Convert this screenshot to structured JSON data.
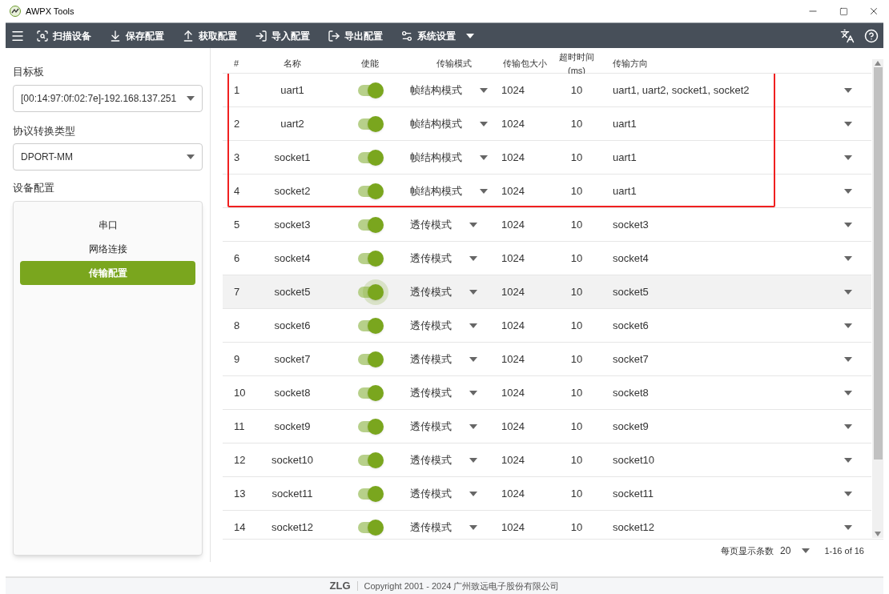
{
  "window": {
    "title": "AWPX Tools"
  },
  "toolbar": [
    {
      "label": "扫描设备",
      "kind": "scan"
    },
    {
      "label": "保存配置",
      "kind": "save"
    },
    {
      "label": "获取配置",
      "kind": "fetch"
    },
    {
      "label": "导入配置",
      "kind": "import"
    },
    {
      "label": "导出配置",
      "kind": "export"
    },
    {
      "label": "系统设置",
      "kind": "settings"
    }
  ],
  "sidebar": {
    "target_label": "目标板",
    "target_value": "[00:14:97:0f:02:7e]-192.168.137.251",
    "protocol_label": "协议转换类型",
    "protocol_value": "DPORT-MM",
    "config_label": "设备配置",
    "config_items": [
      {
        "label": "串口",
        "selected": false
      },
      {
        "label": "网络连接",
        "selected": false
      },
      {
        "label": "传输配置",
        "selected": true
      }
    ]
  },
  "table": {
    "columns": [
      "#",
      "名称",
      "使能",
      "传输模式",
      "传输包大小",
      "超时时间(ms)",
      "传输方向"
    ],
    "rows": [
      {
        "index": "1",
        "name": "uart1",
        "on": true,
        "mode": "帧结构模式",
        "size": "1024",
        "timeout": "10",
        "direction": "uart1, uart2, socket1, socket2",
        "outlined": true,
        "highlighted": false
      },
      {
        "index": "2",
        "name": "uart2",
        "on": true,
        "mode": "帧结构模式",
        "size": "1024",
        "timeout": "10",
        "direction": "uart1",
        "outlined": true,
        "highlighted": false
      },
      {
        "index": "3",
        "name": "socket1",
        "on": true,
        "mode": "帧结构模式",
        "size": "1024",
        "timeout": "10",
        "direction": "uart1",
        "outlined": true,
        "highlighted": false
      },
      {
        "index": "4",
        "name": "socket2",
        "on": true,
        "mode": "帧结构模式",
        "size": "1024",
        "timeout": "10",
        "direction": "uart1",
        "outlined": true,
        "highlighted": false
      },
      {
        "index": "5",
        "name": "socket3",
        "on": true,
        "mode": "透传模式",
        "size": "1024",
        "timeout": "10",
        "direction": "socket3",
        "outlined": false,
        "highlighted": false
      },
      {
        "index": "6",
        "name": "socket4",
        "on": true,
        "mode": "透传模式",
        "size": "1024",
        "timeout": "10",
        "direction": "socket4",
        "outlined": false,
        "highlighted": false
      },
      {
        "index": "7",
        "name": "socket5",
        "on": true,
        "mode": "透传模式",
        "size": "1024",
        "timeout": "10",
        "direction": "socket5",
        "outlined": false,
        "highlighted": true
      },
      {
        "index": "8",
        "name": "socket6",
        "on": true,
        "mode": "透传模式",
        "size": "1024",
        "timeout": "10",
        "direction": "socket6",
        "outlined": false,
        "highlighted": false
      },
      {
        "index": "9",
        "name": "socket7",
        "on": true,
        "mode": "透传模式",
        "size": "1024",
        "timeout": "10",
        "direction": "socket7",
        "outlined": false,
        "highlighted": false
      },
      {
        "index": "10",
        "name": "socket8",
        "on": true,
        "mode": "透传模式",
        "size": "1024",
        "timeout": "10",
        "direction": "socket8",
        "outlined": false,
        "highlighted": false
      },
      {
        "index": "11",
        "name": "socket9",
        "on": true,
        "mode": "透传模式",
        "size": "1024",
        "timeout": "10",
        "direction": "socket9",
        "outlined": false,
        "highlighted": false
      },
      {
        "index": "12",
        "name": "socket10",
        "on": true,
        "mode": "透传模式",
        "size": "1024",
        "timeout": "10",
        "direction": "socket10",
        "outlined": false,
        "highlighted": false
      },
      {
        "index": "13",
        "name": "socket11",
        "on": true,
        "mode": "透传模式",
        "size": "1024",
        "timeout": "10",
        "direction": "socket11",
        "outlined": false,
        "highlighted": false
      },
      {
        "index": "14",
        "name": "socket12",
        "on": true,
        "mode": "透传模式",
        "size": "1024",
        "timeout": "10",
        "direction": "socket12",
        "outlined": false,
        "highlighted": false
      }
    ]
  },
  "pagination": {
    "label": "每页显示条数",
    "page_size": "20",
    "range": "1-16 of 16"
  },
  "footer": {
    "logo": "ZLG",
    "copyright": "Copyright 2001 - 2024 广州致远电子股份有限公司"
  }
}
